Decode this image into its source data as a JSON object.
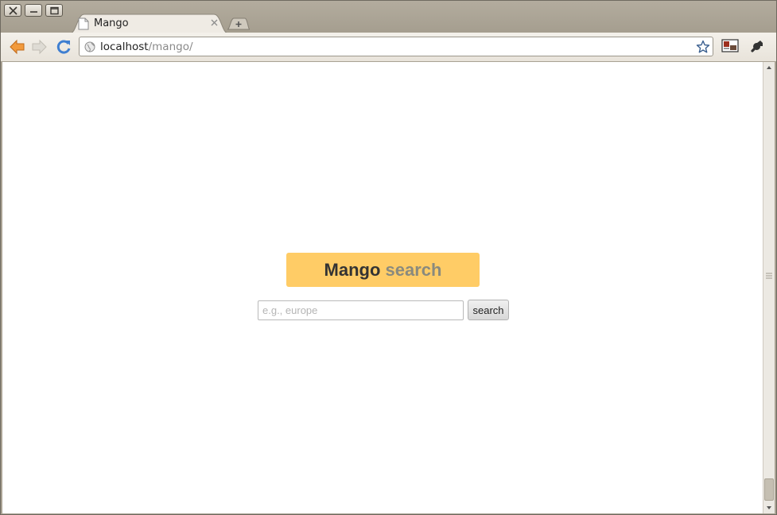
{
  "browser": {
    "tab": {
      "title": "Mango",
      "close_glyph": "×"
    },
    "new_tab_glyph": "+",
    "address_bar": {
      "host": "localhost",
      "path": "/mango/"
    },
    "icons": [
      "close-window-icon",
      "minimize-icon",
      "maximize-icon",
      "page-icon",
      "back-arrow-icon",
      "forward-arrow-icon",
      "reload-icon",
      "globe-icon",
      "star-icon",
      "screenshot-extension-icon",
      "wrench-icon"
    ]
  },
  "page": {
    "logo": {
      "word1": "Mango",
      "word2": "search"
    },
    "search": {
      "placeholder": "e.g., europe",
      "value": "",
      "button_label": "search"
    }
  },
  "colors": {
    "logo_bg": "#ffcc66",
    "logo_word2": "#8a8a7e",
    "page_bg": "#ffffff"
  }
}
